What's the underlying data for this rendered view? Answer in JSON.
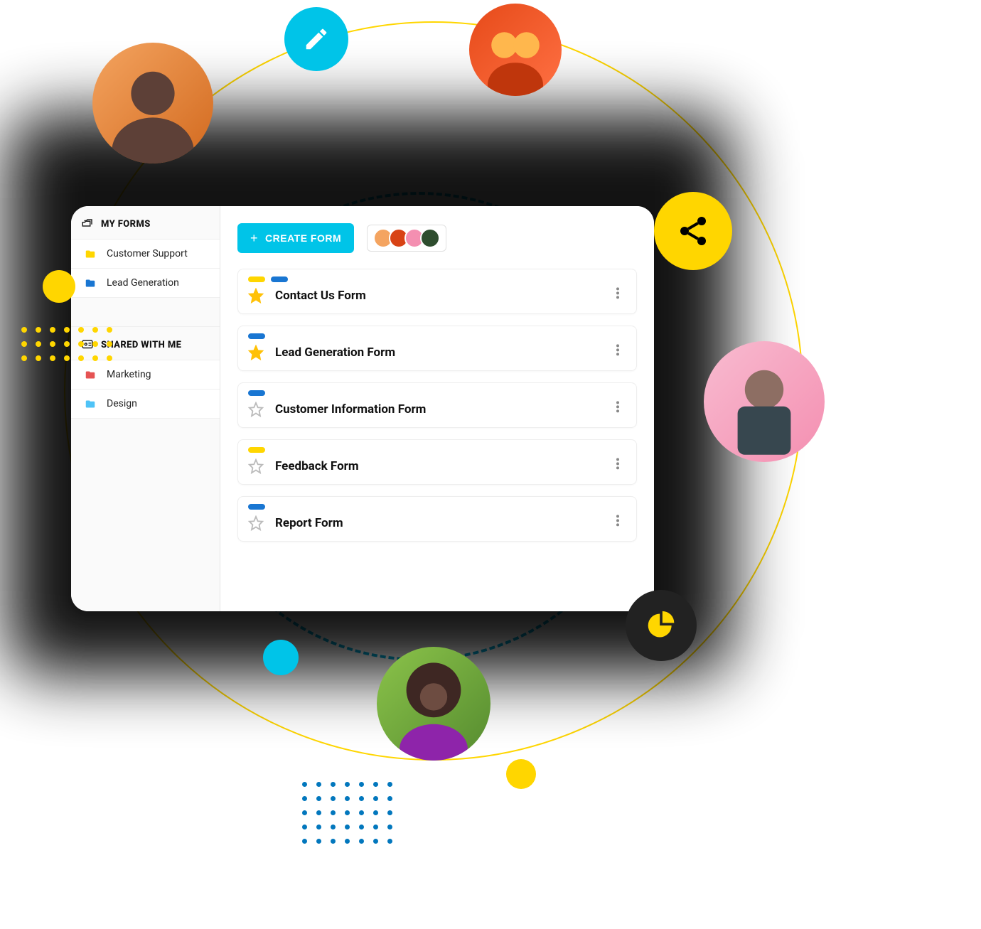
{
  "sidebar": {
    "my_forms_header": "MY FORMS",
    "shared_header": "SHARED WITH ME",
    "my_forms": [
      {
        "label": "Customer Support",
        "color": "#ffd600"
      },
      {
        "label": "Lead Generation",
        "color": "#1976d2"
      }
    ],
    "shared": [
      {
        "label": "Marketing",
        "color": "#e55353"
      },
      {
        "label": "Design",
        "color": "#4fc3f7"
      }
    ]
  },
  "toolbar": {
    "create_label": "CREATE FORM",
    "collaborators": [
      {
        "bg": "#f4a460"
      },
      {
        "bg": "#d84315"
      },
      {
        "bg": "#f48fb1"
      },
      {
        "bg": "#2e4d2e"
      }
    ]
  },
  "forms": [
    {
      "title": "Contact Us Form",
      "starred": true,
      "pills": [
        "y",
        "b"
      ]
    },
    {
      "title": "Lead Generation Form",
      "starred": true,
      "pills": [
        "b"
      ]
    },
    {
      "title": "Customer Information Form",
      "starred": false,
      "pills": [
        "b"
      ]
    },
    {
      "title": "Feedback Form",
      "starred": false,
      "pills": [
        "y"
      ]
    },
    {
      "title": "Report Form",
      "starred": false,
      "pills": [
        "b"
      ]
    }
  ],
  "decor": {
    "bubbles": {
      "pencil": "pencil-icon",
      "share": "share-icon",
      "chart": "pie-chart-icon"
    }
  }
}
